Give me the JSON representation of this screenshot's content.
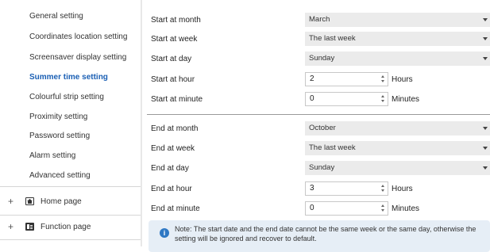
{
  "sidebar": {
    "items": [
      {
        "label": "General setting"
      },
      {
        "label": "Coordinates location setting"
      },
      {
        "label": "Screensaver display setting"
      },
      {
        "label": "Summer time setting"
      },
      {
        "label": "Colourful strip setting"
      },
      {
        "label": "Proximity setting"
      },
      {
        "label": "Password setting"
      },
      {
        "label": "Alarm setting"
      },
      {
        "label": "Advanced setting"
      }
    ],
    "active_index": 3,
    "groups": [
      {
        "label": "Home page",
        "icon": "home-icon",
        "expander": "+"
      },
      {
        "label": "Function page",
        "icon": "function-icon",
        "expander": "+"
      }
    ]
  },
  "start": {
    "month": {
      "label": "Start at month",
      "value": "March"
    },
    "week": {
      "label": "Start at week",
      "value": "The last week"
    },
    "day": {
      "label": "Start at day",
      "value": "Sunday"
    },
    "hour": {
      "label": "Start at hour",
      "value": "2",
      "unit": "Hours"
    },
    "minute": {
      "label": "Start at minute",
      "value": "0",
      "unit": "Minutes"
    }
  },
  "end": {
    "month": {
      "label": "End at month",
      "value": "October"
    },
    "week": {
      "label": "End at week",
      "value": "The last week"
    },
    "day": {
      "label": "End at day",
      "value": "Sunday"
    },
    "hour": {
      "label": "End at hour",
      "value": "3",
      "unit": "Hours"
    },
    "minute": {
      "label": "End at minute",
      "value": "0",
      "unit": "Minutes"
    }
  },
  "note": {
    "icon": "info-icon",
    "text": "Note: The start date and the end date cannot be the same week or the same day, otherwise the setting will be ignored and recover to default."
  },
  "colors": {
    "active": "#1a5fb4",
    "info": "#2f78c4",
    "note_bg": "#e6eef6"
  }
}
